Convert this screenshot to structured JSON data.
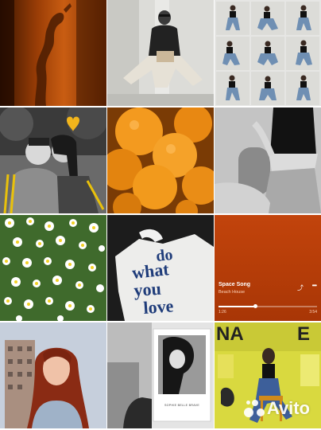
{
  "grid": {
    "tiles": [
      {
        "name": "orange-silhouette-photo",
        "icon": "photo-icon"
      },
      {
        "name": "sitting-woman-photo",
        "icon": "photo-icon"
      },
      {
        "name": "pose-collage-photo",
        "icon": "photo-icon"
      },
      {
        "name": "couple-heart-photo",
        "icon": "photo-icon"
      },
      {
        "name": "oranges-photo",
        "icon": "photo-icon"
      },
      {
        "name": "jeans-torso-photo",
        "icon": "photo-icon"
      },
      {
        "name": "daisies-photo",
        "icon": "photo-icon"
      },
      {
        "name": "do-what-you-love-photo",
        "icon": "photo-icon"
      },
      {
        "name": "music-player-screenshot",
        "icon": "photo-icon"
      },
      {
        "name": "redhead-portrait-photo",
        "icon": "photo-icon"
      },
      {
        "name": "bw-collage-photo",
        "icon": "photo-icon"
      },
      {
        "name": "yellow-poster-photo",
        "icon": "photo-icon"
      }
    ]
  },
  "shirt_text": {
    "line1": "do",
    "line2": "what",
    "line3": "you",
    "line4": "love"
  },
  "player": {
    "song_title": "Space Song",
    "artist": "Beach House",
    "elapsed": "1:26",
    "duration": "3:54",
    "progress": 0.37,
    "share_icon": "share-icon",
    "more_icon": "more-dots-icon"
  },
  "book": {
    "caption": "SOPHIE BELLE BRAVE"
  },
  "watermark": {
    "text": "Avito"
  },
  "colors": {
    "orange_accent": "#e07a10",
    "player_bg": "#b63d08",
    "poster_yellow": "#d7d63e",
    "heart_yellow": "#f2b51c"
  }
}
